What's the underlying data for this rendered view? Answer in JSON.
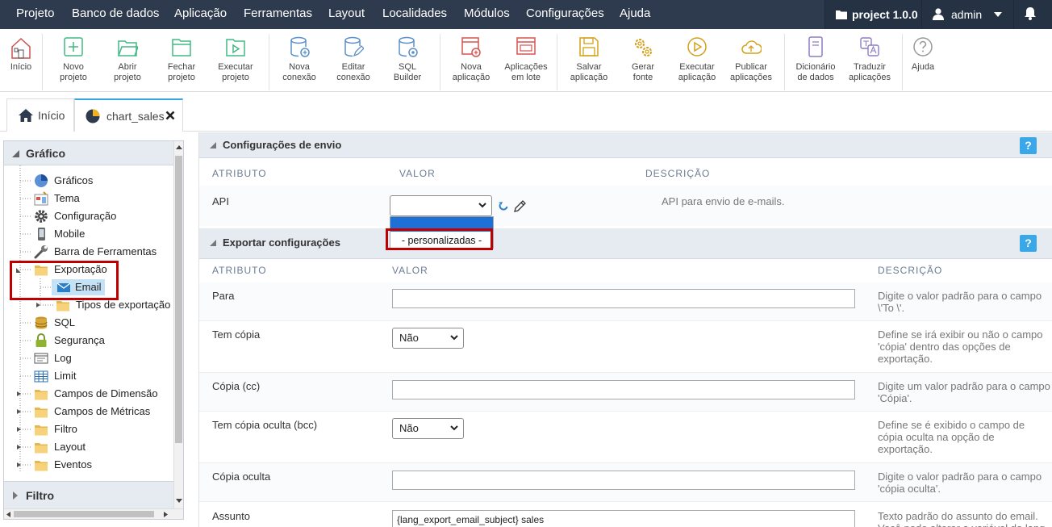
{
  "menu": {
    "items": [
      "Projeto",
      "Banco de dados",
      "Aplicação",
      "Ferramentas",
      "Layout",
      "Localidades",
      "Módulos",
      "Configurações",
      "Ajuda"
    ],
    "project": "project 1.0.0",
    "user": "admin"
  },
  "toolbar": {
    "inicio": "Início",
    "novo_projeto": [
      "Novo",
      "projeto"
    ],
    "abrir_projeto": [
      "Abrir",
      "projeto"
    ],
    "fechar_projeto": [
      "Fechar",
      "projeto"
    ],
    "executar_projeto": [
      "Executar",
      "projeto"
    ],
    "nova_conexao": [
      "Nova",
      "conexão"
    ],
    "editar_conexao": [
      "Editar",
      "conexão"
    ],
    "sql_builder": [
      "SQL",
      "Builder"
    ],
    "nova_aplicacao": [
      "Nova",
      "aplicação"
    ],
    "aplicacoes_lote": [
      "Aplicações",
      "em lote"
    ],
    "salvar_aplicacao": [
      "Salvar",
      "aplicação"
    ],
    "gerar_fonte": [
      "Gerar",
      "fonte"
    ],
    "executar_aplicacao": [
      "Executar",
      "aplicação"
    ],
    "publicar_aplicacoes": [
      "Publicar",
      "aplicações"
    ],
    "dicionario_dados": [
      "Dicionário",
      "de dados"
    ],
    "traduzir_aplicacoes": [
      "Traduzir",
      "aplicações"
    ],
    "ajuda": "Ajuda"
  },
  "tabs": {
    "home": "Início",
    "app": "chart_sales"
  },
  "sidebar": {
    "title": "Gráfico",
    "footer": "Filtro",
    "items": [
      {
        "label": "Gráficos",
        "icon": "pie-chart-icon"
      },
      {
        "label": "Tema",
        "icon": "theme-icon"
      },
      {
        "label": "Configuração",
        "icon": "gear-icon"
      },
      {
        "label": "Mobile",
        "icon": "mobile-icon"
      },
      {
        "label": "Barra de Ferramentas",
        "icon": "wrench-icon"
      },
      {
        "label": "Exportação",
        "icon": "folder-icon"
      },
      {
        "label": "Email",
        "icon": "email-icon"
      },
      {
        "label": "Tipos de exportação",
        "icon": "folder-icon"
      },
      {
        "label": "SQL",
        "icon": "database-icon"
      },
      {
        "label": "Segurança",
        "icon": "lock-icon"
      },
      {
        "label": "Log",
        "icon": "log-icon"
      },
      {
        "label": "Limit",
        "icon": "table-icon"
      },
      {
        "label": "Campos de Dimensão",
        "icon": "folder-icon"
      },
      {
        "label": "Campos de Métricas",
        "icon": "folder-icon"
      },
      {
        "label": "Filtro",
        "icon": "folder-icon"
      },
      {
        "label": "Layout",
        "icon": "folder-icon"
      },
      {
        "label": "Eventos",
        "icon": "folder-icon"
      }
    ]
  },
  "envio": {
    "title": "Configurações de envio",
    "col_atributo": "ATRIBUTO",
    "col_valor": "VALOR",
    "col_descricao": "DESCRIÇÃO",
    "api_label": "API",
    "api_value": "",
    "api_option": "- personalizadas -",
    "api_desc": "API para envio de e-mails."
  },
  "exportar": {
    "title": "Exportar configurações",
    "col_atributo": "ATRIBUTO",
    "col_valor": "VALOR",
    "col_descricao": "DESCRIÇÃO",
    "rows": [
      {
        "label": "Para",
        "value": "",
        "desc": "Digite o valor padrão para o campo \\'To \\'."
      },
      {
        "label": "Tem cópia",
        "value": "Não",
        "desc": "Define se irá exibir ou não o campo 'cópia' dentro das opções de exportação."
      },
      {
        "label": "Cópia (cc)",
        "value": "",
        "desc": "Digite um valor padrão para o campo 'Cópia'."
      },
      {
        "label": "Tem cópia oculta (bcc)",
        "value": "Não",
        "desc": "Define se é exibido o campo de cópia oculta na opção de exportação."
      },
      {
        "label": "Cópia oculta",
        "value": "",
        "desc": "Digite o valor padrão para o campo 'cópia oculta'."
      },
      {
        "label": "Assunto",
        "value": "{lang_export_email_subject} sales",
        "desc": "Texto padrão do assunto do email. Você pode alterar a variável da lang"
      }
    ]
  },
  "help_label": "?",
  "colors": {
    "menubar": "#2e3b4e",
    "accent": "#38a6de",
    "highlight": "#c00000",
    "section": "#e6ebf2"
  }
}
